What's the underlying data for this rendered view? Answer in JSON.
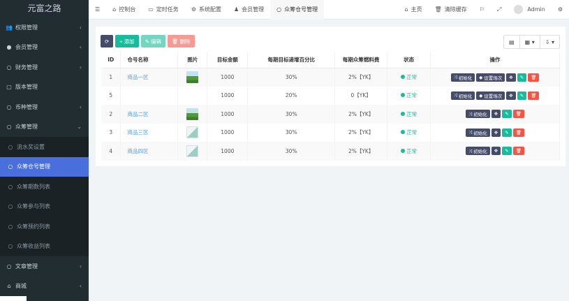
{
  "app": {
    "title": "元富之路"
  },
  "sidebar": {
    "items": [
      {
        "label": "权限管理",
        "icon": "group-icon",
        "arrow": "‹"
      },
      {
        "label": "会员管理",
        "icon": "user-circle-icon",
        "arrow": "‹"
      },
      {
        "label": "财务管理",
        "icon": "circle-icon",
        "arrow": "‹"
      },
      {
        "label": "版本管理",
        "icon": "file-icon",
        "arrow": ""
      },
      {
        "label": "币种管理",
        "icon": "circle-icon",
        "arrow": "‹"
      },
      {
        "label": "众筹管理",
        "icon": "circle-icon",
        "arrow": "⌄"
      }
    ],
    "sub": [
      {
        "label": "流水奖设置"
      },
      {
        "label": "众筹仓号管理",
        "active": true
      },
      {
        "label": "众筹期数列表"
      },
      {
        "label": "众筹参与列表"
      },
      {
        "label": "众筹预约列表"
      },
      {
        "label": "众筹收益列表"
      }
    ],
    "bottom": [
      {
        "label": "文章管理",
        "arrow": "‹"
      },
      {
        "label": "商城",
        "arrow": "‹"
      }
    ]
  },
  "topnav": {
    "tabs": [
      {
        "label": "控制台"
      },
      {
        "label": "定时任务"
      },
      {
        "label": "系统配置"
      },
      {
        "label": "会员管理"
      },
      {
        "label": "众筹仓号管理"
      }
    ],
    "home": "主页",
    "clear_cache": "清除缓存",
    "user": "Admin"
  },
  "toolbar": {
    "add": "添加",
    "edit": "编辑",
    "delete": "删除"
  },
  "table": {
    "headers": [
      "ID",
      "仓号名称",
      "图片",
      "目标金额",
      "每期目标递增百分比",
      "每期众筹燃料费",
      "状态",
      "操作"
    ],
    "rows": [
      {
        "id": "1",
        "name": "商品一区",
        "img": "t1",
        "amount": "1000",
        "pct": "30%",
        "fee": "2%【YK】",
        "status": "正常",
        "reset": true
      },
      {
        "id": "5",
        "name": "",
        "img": "",
        "amount": "1000",
        "pct": "20%",
        "fee": "0【YK】",
        "status": "正常",
        "reset": true
      },
      {
        "id": "2",
        "name": "商品二区",
        "img": "t1",
        "amount": "1000",
        "pct": "30%",
        "fee": "2%【YK】",
        "status": "正常",
        "reset": false
      },
      {
        "id": "3",
        "name": "商品三区",
        "img": "t2",
        "amount": "1000",
        "pct": "30%",
        "fee": "2%【YK】",
        "status": "正常",
        "reset": false
      },
      {
        "id": "4",
        "name": "商品四区",
        "img": "t2",
        "amount": "1000",
        "pct": "30%",
        "fee": "2%【YK】",
        "status": "正常",
        "reset": false
      }
    ],
    "op_init": "初始化",
    "op_reset": "设置场次"
  }
}
